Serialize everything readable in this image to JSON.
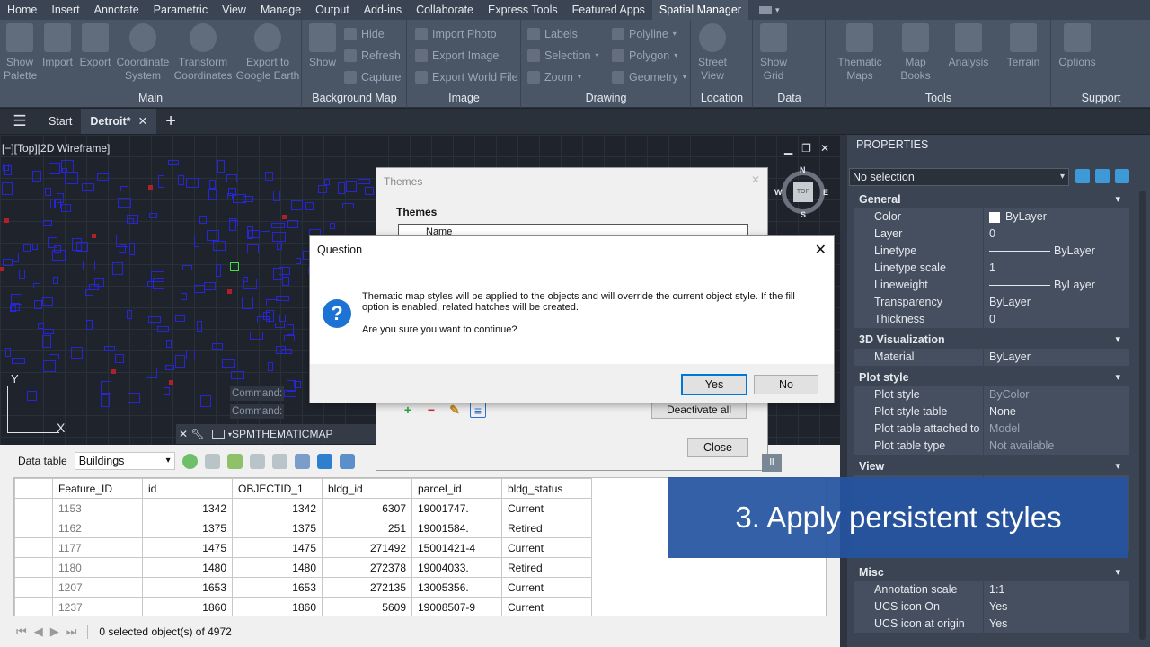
{
  "menu": {
    "tabs": [
      "Home",
      "Insert",
      "Annotate",
      "Parametric",
      "View",
      "Manage",
      "Output",
      "Add-ins",
      "Collaborate",
      "Express Tools",
      "Featured Apps",
      "Spatial Manager"
    ],
    "active": "Spatial Manager"
  },
  "ribbon": {
    "main": {
      "title": "Main",
      "show_palette": "Show Palette",
      "import": "Import",
      "export": "Export",
      "coordinate_system": "Coordinate System",
      "transform_coordinates": "Transform Coordinates",
      "export_google_earth": "Export to Google Earth"
    },
    "background_map": {
      "title": "Background Map",
      "show": "Show",
      "hide": "Hide",
      "refresh": "Refresh",
      "capture": "Capture"
    },
    "image": {
      "title": "Image",
      "import_photo": "Import Photo",
      "export_image": "Export Image",
      "export_world_file": "Export World File"
    },
    "drawing": {
      "title": "Drawing",
      "labels": "Labels",
      "selection": "Selection",
      "zoom": "Zoom",
      "polyline": "Polyline",
      "polygon": "Polygon",
      "geometry": "Geometry"
    },
    "location": {
      "title": "Location",
      "street_view": "Street View"
    },
    "data": {
      "title": "Data",
      "show_grid": "Show Grid"
    },
    "tools": {
      "title": "Tools",
      "thematic_maps": "Thematic Maps",
      "map_books": "Map Books",
      "analysis": "Analysis",
      "terrain": "Terrain"
    },
    "support": {
      "title": "Support",
      "options": "Options"
    }
  },
  "filetabs": {
    "start": "Start",
    "current": "Detroit*"
  },
  "viewport": {
    "label": "[−][Top][2D Wireframe]",
    "cube_top": "TOP",
    "n": "N",
    "s": "S",
    "e": "E",
    "w": "W",
    "cmd1": "Command:",
    "cmd2": "Command:",
    "axis_y": "Y",
    "axis_x": "X"
  },
  "cmdline": {
    "text": "SPMTHEMATICMAP"
  },
  "datatable": {
    "label": "Data table",
    "table_selected": "Buildings",
    "columns": [
      "Feature_ID",
      "id",
      "OBJECTID_1",
      "bldg_id",
      "parcel_id",
      "bldg_status"
    ],
    "rows": [
      [
        "1153",
        "1342",
        "1342",
        "6307",
        "19001747.",
        "Current"
      ],
      [
        "1162",
        "1375",
        "1375",
        "251",
        "19001584.",
        "Retired"
      ],
      [
        "1177",
        "1475",
        "1475",
        "271492",
        "15001421-4",
        "Current"
      ],
      [
        "1180",
        "1480",
        "1480",
        "272378",
        "19004033.",
        "Retired"
      ],
      [
        "1207",
        "1653",
        "1653",
        "272135",
        "13005356.",
        "Current"
      ],
      [
        "1237",
        "1860",
        "1860",
        "5609",
        "19008507-9",
        "Current"
      ]
    ],
    "status": "0 selected object(s) of 4972"
  },
  "properties": {
    "title": "PROPERTIES",
    "selection": "No selection",
    "general": {
      "title": "General",
      "color_k": "Color",
      "color_v": "ByLayer",
      "layer_k": "Layer",
      "layer_v": "0",
      "linetype_k": "Linetype",
      "linetype_v": "ByLayer",
      "ltscale_k": "Linetype scale",
      "ltscale_v": "1",
      "lineweight_k": "Lineweight",
      "lineweight_v": "ByLayer",
      "transparency_k": "Transparency",
      "transparency_v": "ByLayer",
      "thickness_k": "Thickness",
      "thickness_v": "0"
    },
    "viz3d": {
      "title": "3D Visualization",
      "material_k": "Material",
      "material_v": "ByLayer"
    },
    "plot": {
      "title": "Plot style",
      "ps_k": "Plot style",
      "ps_v": "ByColor",
      "pst_k": "Plot style table",
      "pst_v": "None",
      "pta_k": "Plot table attached to",
      "pta_v": "Model",
      "ptt_k": "Plot table type",
      "ptt_v": "Not available"
    },
    "view": {
      "title": "View"
    },
    "misc": {
      "title": "Misc",
      "ann_k": "Annotation scale",
      "ann_v": "1:1",
      "ucson_k": "UCS icon On",
      "ucson_v": "Yes",
      "ucsorigin_k": "UCS icon at origin",
      "ucsorigin_v": "Yes"
    }
  },
  "themes_dialog": {
    "title": "Themes",
    "group": "Themes",
    "name_col": "Name",
    "deactivate_all": "Deactivate all",
    "close": "Close",
    "peek": "ll"
  },
  "question_dialog": {
    "title": "Question",
    "message": "Thematic map styles will be applied to the objects and will override the current object style. If the fill option is enabled, related hatches will be created.",
    "ask": "Are you sure you want to continue?",
    "yes": "Yes",
    "no": "No"
  },
  "caption": "3. Apply persistent styles"
}
